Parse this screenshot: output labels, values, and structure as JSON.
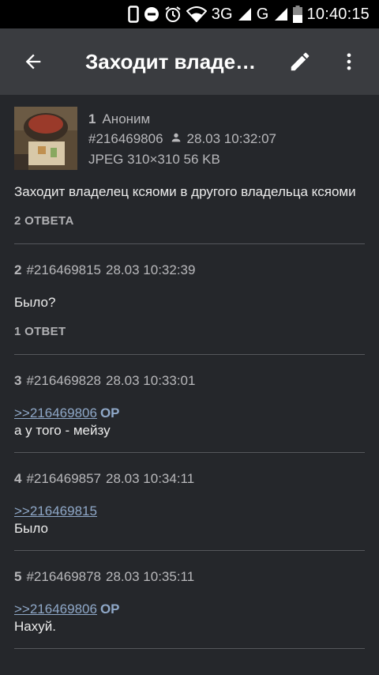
{
  "status": {
    "network_3g": "3G",
    "network_g": "G",
    "time": "10:40:15"
  },
  "toolbar": {
    "title": "Заходит владе…",
    "back_icon": "arrow-back-icon",
    "edit_icon": "pencil-icon",
    "menu_icon": "more-vert-icon"
  },
  "op": {
    "num": "1",
    "name": "Аноним",
    "id": "#216469806",
    "date": "28.03 10:32:07",
    "file": "JPEG 310×310 56 KB",
    "comment": "Заходит владелец ксяоми в другого владельца ксяоми",
    "replies": "2 ОТВЕТА"
  },
  "posts": [
    {
      "num": "2",
      "id": "#216469815",
      "date": "28.03 10:32:39",
      "link": "",
      "op": "",
      "comment": "Было?",
      "replies": "1 ОТВЕТ"
    },
    {
      "num": "3",
      "id": "#216469828",
      "date": "28.03 10:33:01",
      "link": ">>216469806",
      "op": "OP",
      "comment": "а у того - мейзу",
      "replies": ""
    },
    {
      "num": "4",
      "id": "#216469857",
      "date": "28.03 10:34:11",
      "link": ">>216469815",
      "op": "",
      "comment": "Было",
      "replies": ""
    },
    {
      "num": "5",
      "id": "#216469878",
      "date": "28.03 10:35:11",
      "link": ">>216469806",
      "op": "OP",
      "comment": "Нахуй.",
      "replies": ""
    }
  ]
}
